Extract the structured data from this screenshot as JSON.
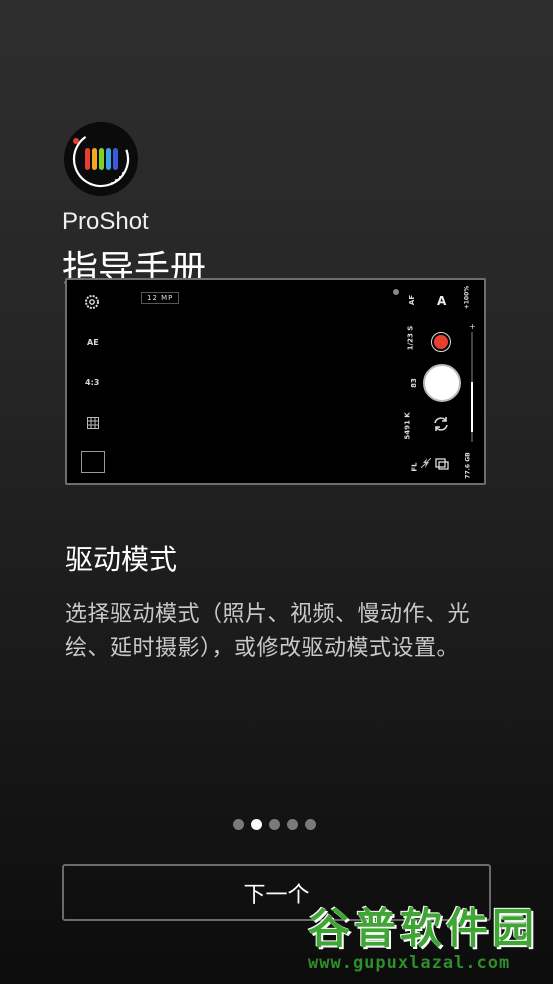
{
  "app": {
    "name": "ProShot",
    "guide_title": "指导手册"
  },
  "preview": {
    "left_controls": [
      "AE",
      "4:3"
    ],
    "megapixels": "12 MP",
    "right_labels": {
      "af": "AF",
      "mode": "A",
      "shutter_speed": "1/23 S",
      "iso": "83",
      "white_balance": "5491 K",
      "focal": "FL",
      "storage": "77.6 GB",
      "zoom_top": "+100%"
    }
  },
  "section": {
    "title": "驱动模式",
    "description": "选择驱动模式（照片、视频、慢动作、光绘、延时摄影），或修改驱动模式设置。"
  },
  "pager": {
    "total": 5,
    "active_index": 1
  },
  "next_button": {
    "label": "下一个"
  },
  "watermark": {
    "text": "谷普软件园",
    "url": "www.gupuxlazal.com"
  },
  "colors": {
    "record": "#e8402e",
    "watermark_green": "#3fa534"
  }
}
